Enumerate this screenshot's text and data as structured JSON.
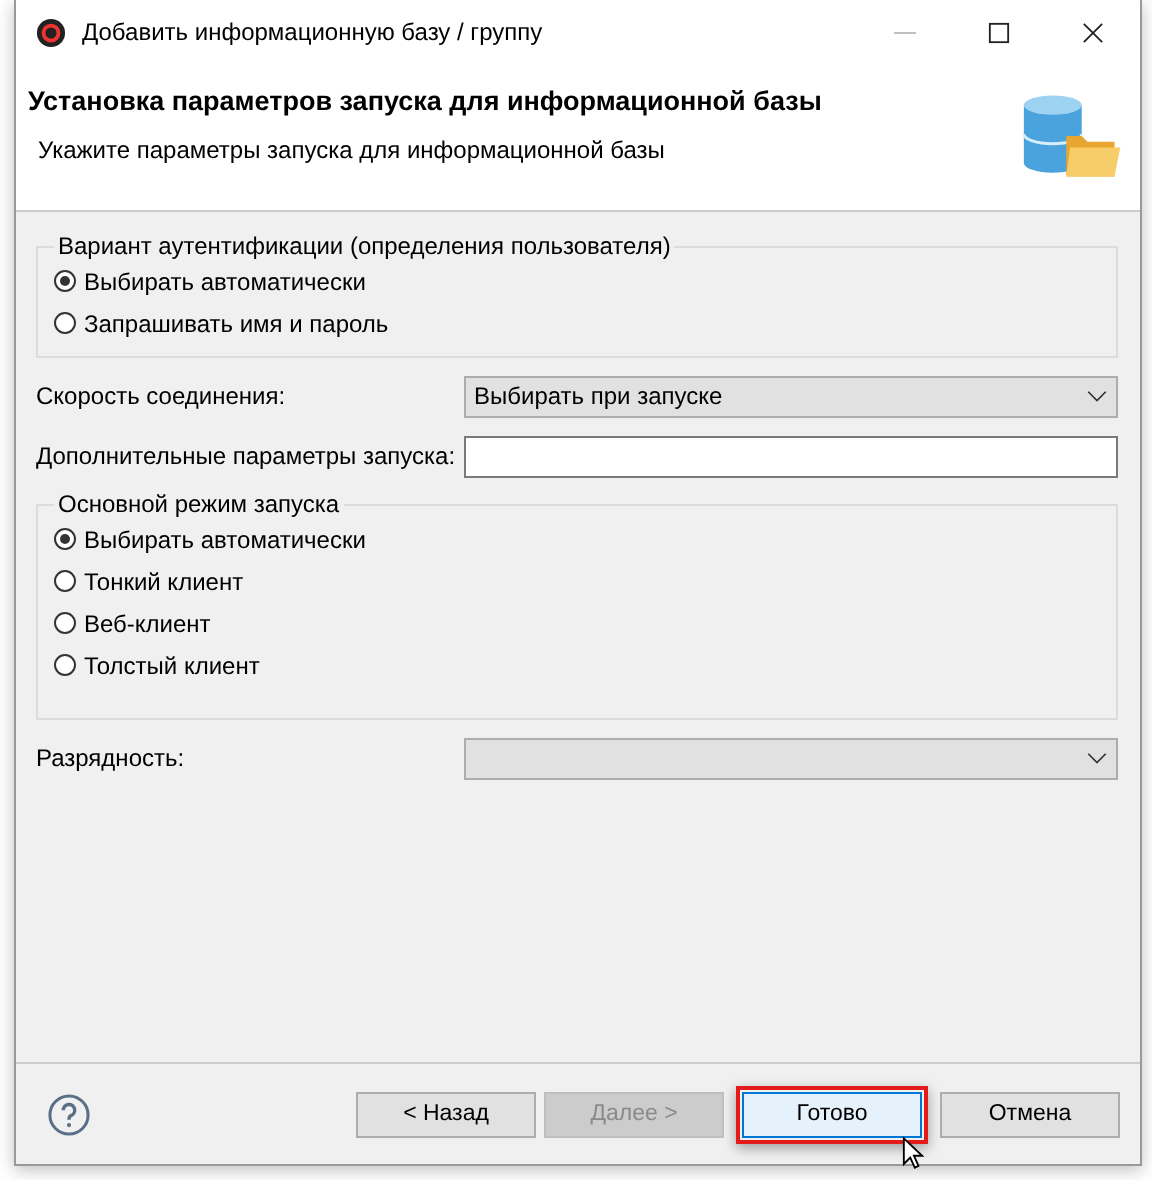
{
  "window": {
    "title": "Добавить информационную базу / группу"
  },
  "header": {
    "title": "Установка параметров запуска для информационной базы",
    "subtitle": "Укажите параметры запуска для информационной базы"
  },
  "auth_group": {
    "legend": "Вариант аутентификации (определения пользователя)",
    "options": [
      {
        "label": "Выбирать автоматически",
        "selected": true
      },
      {
        "label": "Запрашивать имя и пароль",
        "selected": false
      }
    ]
  },
  "connection_speed": {
    "label": "Скорость соединения:",
    "value": "Выбирать при запуске"
  },
  "extra_params": {
    "label": "Дополнительные параметры запуска:"
  },
  "mode_group": {
    "legend": "Основной режим запуска",
    "options": [
      {
        "label": "Выбирать автоматически",
        "selected": true
      },
      {
        "label": "Тонкий клиент",
        "selected": false
      },
      {
        "label": "Веб-клиент",
        "selected": false
      },
      {
        "label": "Толстый клиент",
        "selected": false
      }
    ]
  },
  "bitness": {
    "label": "Разрядность:"
  },
  "buttons": [
    {
      "label": "< Назад",
      "disabled": false,
      "highlighted": false
    },
    {
      "label": "Далее >",
      "disabled": true,
      "highlighted": false
    },
    {
      "label": "Готово",
      "disabled": false,
      "highlighted": true
    },
    {
      "label": "Отмена",
      "disabled": false,
      "highlighted": false
    }
  ]
}
